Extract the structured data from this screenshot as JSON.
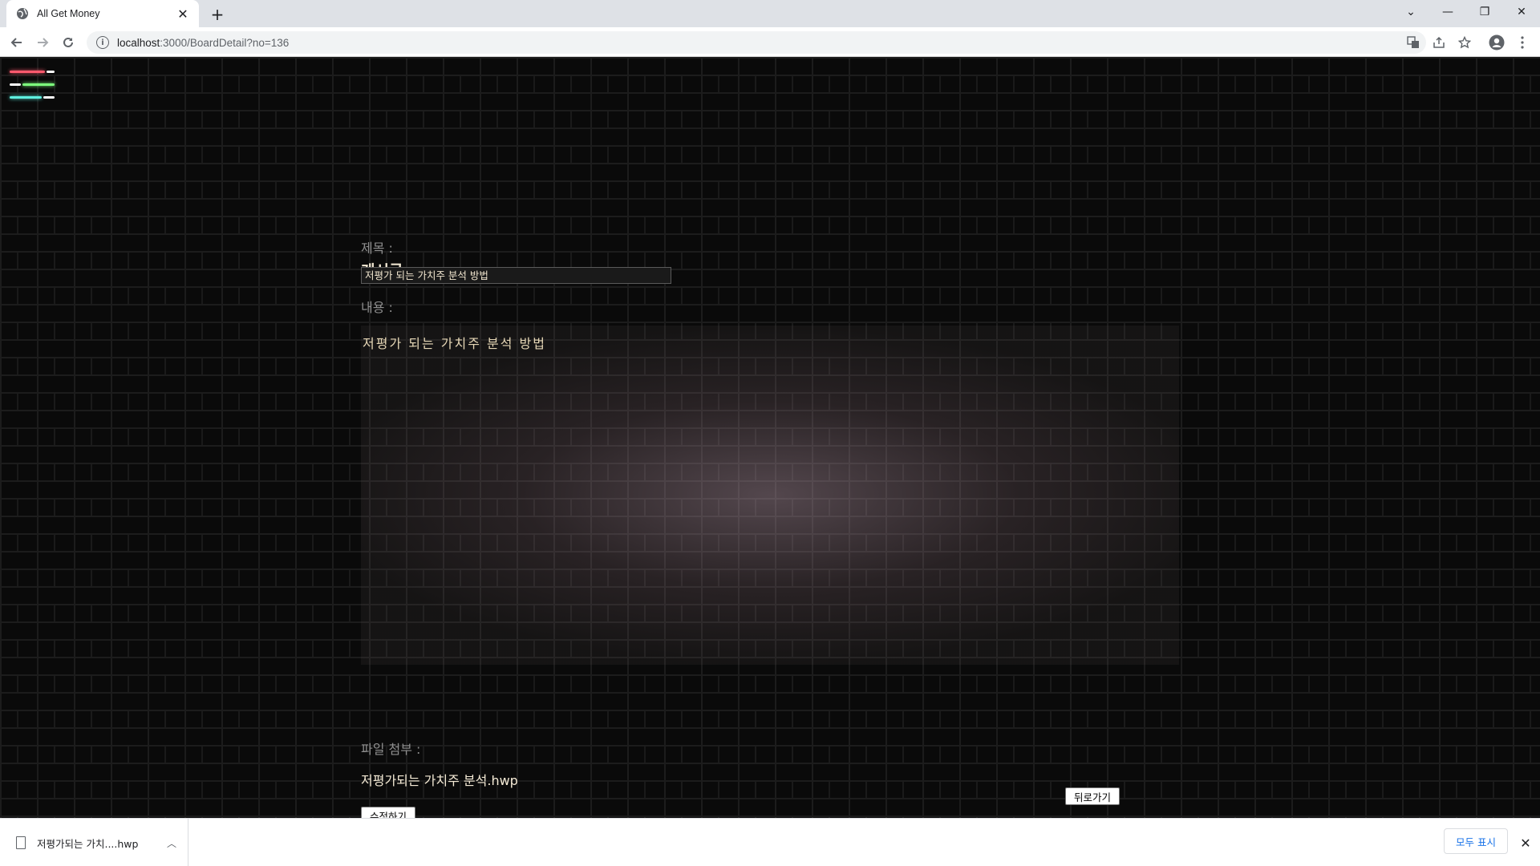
{
  "browser": {
    "tab_title": "All Get Money",
    "new_tab_symbol": "+",
    "tab_close_symbol": "✕",
    "url_host": "localhost",
    "url_path": ":3000/BoardDetail?no=136",
    "window_controls": {
      "dropdown": "⌄",
      "minimize": "—",
      "restore": "❐",
      "close": "✕"
    }
  },
  "page": {
    "heading": "게시글",
    "title_label": "제목 :",
    "title_value": "저평가 되는 가치주 분석 방법",
    "content_label": "내용 :",
    "content_value": "저평가 되는 가치주 분석 방법",
    "file_label": "파일 첨부 :",
    "file_name": "저평가되는 가치주 분석.hwp",
    "edit_button": "수정하기",
    "back_button": "뒤로가기",
    "menu_colors": [
      "#ff5a6e",
      "#7dff7d",
      "#5ff0e0"
    ]
  },
  "downloads": {
    "item_name": "저평가되는 가치....hwp",
    "show_all": "모두 표시",
    "close_symbol": "✕"
  }
}
